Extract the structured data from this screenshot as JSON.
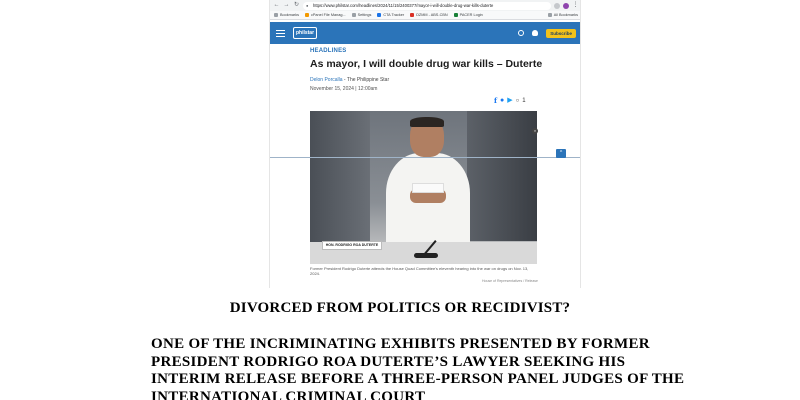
{
  "browser": {
    "url": "https://www.philstar.com/headlines/2024/11/15/2400377/mayor-i-will-double-drug-war-kills-duterte",
    "bookmarks": [
      "Bookmarks",
      "cPanel File Manag...",
      "Settings",
      "CTA Tracker",
      "DZMM - ABS-CBN",
      "PACER Login"
    ],
    "all_bookmarks": "All Bookmarks"
  },
  "site": {
    "logo": "philstar",
    "subscribe": "Subscribe"
  },
  "article": {
    "category": "HEADLINES",
    "title": "As mayor, I will double drug war kills – Duterte",
    "author": "Delon Porcalla",
    "publication": "- The Philippine Star",
    "date": "November 15, 2024 | 12:00am",
    "comment_count": "1",
    "nameplate": "HON. RODRIGO ROA DUTERTE",
    "caption": "Former President Rodrigo Duterte attends the House Quad Committee's eleventh hearing into the war on drugs on Nov. 13, 2024.",
    "photo_credit": "House of Representatives / Release"
  },
  "document": {
    "heading": "DIVORCED FROM POLITICS OR RECIDIVIST?",
    "paragraph": "ONE OF THE INCRIMINATING EXHIBITS PRESENTED BY FORMER PRESIDENT RODRIGO ROA DUTERTE’S LAWYER SEEKING HIS INTERIM RELEASE BEFORE A THREE-PERSON PANEL JUDGES OF THE INTERNATIONAL CRIMINAL COURT"
  }
}
